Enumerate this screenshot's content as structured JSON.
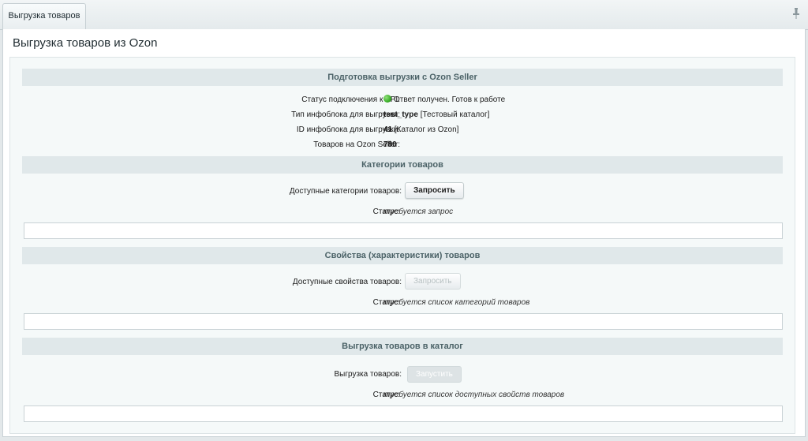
{
  "tab": {
    "label": "Выгрузка товаров"
  },
  "page": {
    "title": "Выгрузка товаров из Ozon"
  },
  "sections": {
    "prepare": {
      "title": "Подготовка выгрузки с Ozon Seller",
      "api_status_label": "Статус подключения к API:",
      "api_status_value": "Ответ получен. Готов к работе",
      "api_status_color": "#2ea61c",
      "iblock_type_label": "Тип инфоблока для выгрузки:",
      "iblock_type_code": "test_type",
      "iblock_type_name": "[Тестовый каталог]",
      "iblock_id_label": "ID инфоблока для выгрузки:",
      "iblock_id_value": "41",
      "iblock_id_name": "[Каталог из Ozon]",
      "goods_count_label": "Товаров на Ozon Seller:",
      "goods_count_value": "780"
    },
    "categories": {
      "title": "Категории товаров",
      "available_label": "Доступные категории товаров:",
      "button_label": "Запросить",
      "status_label": "Статус:",
      "status_value": "требуется запрос",
      "output": ""
    },
    "properties": {
      "title": "Свойства (характеристики) товаров",
      "available_label": "Доступные свойства товаров:",
      "button_label": "Запросить",
      "status_label": "Статус:",
      "status_value": "требуется список категорий товаров",
      "output": ""
    },
    "export": {
      "title": "Выгрузка товаров в каталог",
      "export_label": "Выгрузка товаров:",
      "button_label": "Запустить",
      "status_label": "Статус:",
      "status_value": "требуется список доступных свойств товаров",
      "output": ""
    }
  },
  "icons": {
    "pin": "pin-icon",
    "status_dot": "green-dot-icon"
  }
}
